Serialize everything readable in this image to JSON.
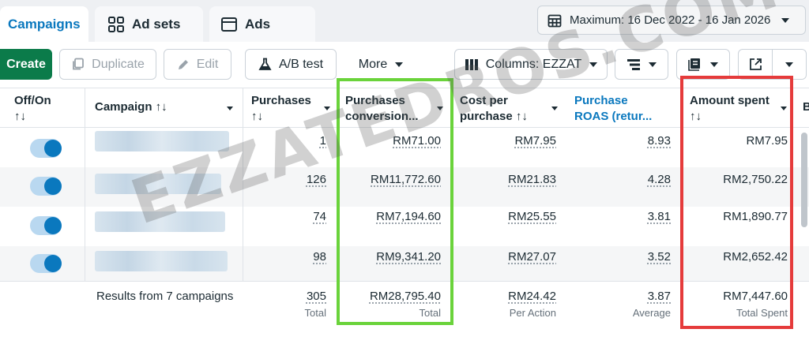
{
  "tabs": [
    {
      "label": "Campaigns",
      "icon": "folder-icon",
      "active": true
    },
    {
      "label": "Ad sets",
      "icon": "grid-icon",
      "active": false
    },
    {
      "label": "Ads",
      "icon": "ad-icon",
      "active": false
    }
  ],
  "date_range": {
    "label": "Maximum: 16 Dec 2022 - 16 Jan 2026",
    "icon": "calendar-icon"
  },
  "toolbar": {
    "create": "Create",
    "duplicate": "Duplicate",
    "edit": "Edit",
    "ab_test": "A/B test",
    "more": "More",
    "columns": "Columns: EZZAT"
  },
  "columns": {
    "offon": "Off/On",
    "offon_sort": "↑↓",
    "campaign": "Campaign ↑↓",
    "purchases": "Purchases",
    "purchases_sort": "↑↓",
    "pcv_1": "Purchases",
    "pcv_2": "conversion...",
    "cpp_1": "Cost per",
    "cpp_2": "purchase ↑↓",
    "roas_1": "Purchase",
    "roas_2": "ROAS (retur...",
    "spent": "Amount spent",
    "spent_sort": "↑↓",
    "next": "B"
  },
  "rows": [
    {
      "on": true,
      "purchases": "1",
      "conversion_value": "RM71.00",
      "cost_per_purchase": "RM7.95",
      "roas": "8.93",
      "amount_spent": "RM7.95"
    },
    {
      "on": true,
      "purchases": "126",
      "conversion_value": "RM11,772.60",
      "cost_per_purchase": "RM21.83",
      "roas": "4.28",
      "amount_spent": "RM2,750.22"
    },
    {
      "on": true,
      "purchases": "74",
      "conversion_value": "RM7,194.60",
      "cost_per_purchase": "RM25.55",
      "roas": "3.81",
      "amount_spent": "RM1,890.77"
    },
    {
      "on": true,
      "purchases": "98",
      "conversion_value": "RM9,341.20",
      "cost_per_purchase": "RM27.07",
      "roas": "3.52",
      "amount_spent": "RM2,652.42"
    }
  ],
  "totals": {
    "label": "Results from 7 campaigns",
    "purchases": "305",
    "purchases_sub": "Total",
    "conversion_value": "RM28,795.40",
    "conversion_value_sub": "Total",
    "cost_per_purchase": "RM24.42",
    "cost_per_purchase_sub": "Per Action",
    "roas": "3.87",
    "roas_sub": "Average",
    "amount_spent": "RM7,447.60",
    "amount_spent_sub": "Total Spent"
  },
  "watermark": "EZZATEDROS.COM",
  "colors": {
    "accent": "#0a78be",
    "create": "#0b7b4a",
    "highlight_green": "#6ad33b",
    "highlight_red": "#e53b3b"
  }
}
